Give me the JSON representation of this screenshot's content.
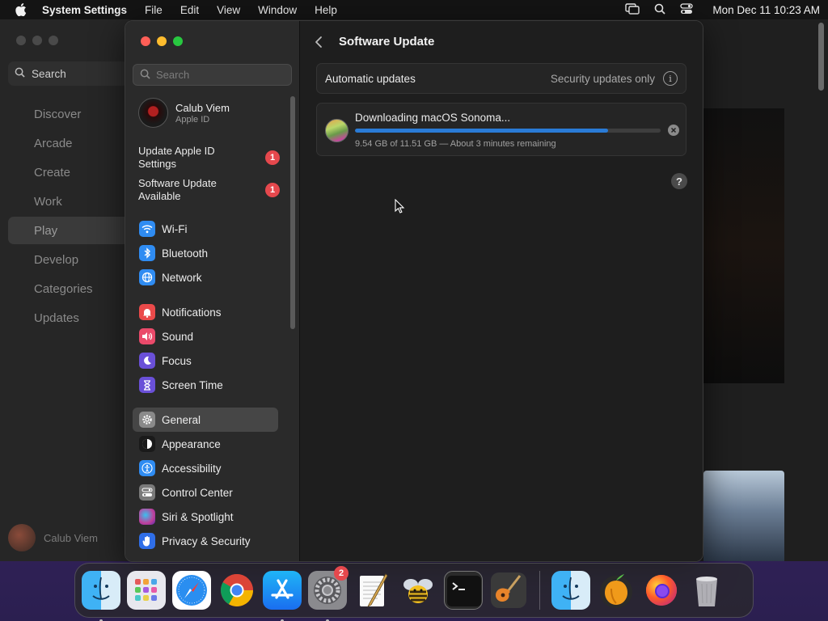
{
  "menubar": {
    "app_name": "System Settings",
    "items": [
      "File",
      "Edit",
      "View",
      "Window",
      "Help"
    ],
    "clock": "Mon Dec 11  10:23 AM"
  },
  "background_app": {
    "search_label": "Search",
    "nav": [
      "Discover",
      "Arcade",
      "Create",
      "Work",
      "Play",
      "Develop",
      "Categories",
      "Updates"
    ],
    "active_nav": "Play",
    "user_name": "Calub Viem"
  },
  "settings": {
    "search_placeholder": "Search",
    "account": {
      "name": "Calub Viem",
      "subtitle": "Apple ID"
    },
    "alerts": [
      {
        "label": "Update Apple ID Settings",
        "count": "1"
      },
      {
        "label": "Software Update Available",
        "count": "1"
      }
    ],
    "groups": [
      [
        {
          "label": "Wi-Fi",
          "icon": "wifi-icon",
          "color": "#2f8cf2"
        },
        {
          "label": "Bluetooth",
          "icon": "bluetooth-icon",
          "color": "#2f8cf2"
        },
        {
          "label": "Network",
          "icon": "globe-icon",
          "color": "#2f8cf2"
        }
      ],
      [
        {
          "label": "Notifications",
          "icon": "bell-icon",
          "color": "#ea4a4a"
        },
        {
          "label": "Sound",
          "icon": "speaker-icon",
          "color": "#ea4a6a"
        },
        {
          "label": "Focus",
          "icon": "moon-icon",
          "color": "#6a50d8"
        },
        {
          "label": "Screen Time",
          "icon": "hourglass-icon",
          "color": "#6a50d8"
        }
      ],
      [
        {
          "label": "General",
          "icon": "gear-icon",
          "color": "#8a8a8a",
          "selected": true
        },
        {
          "label": "Appearance",
          "icon": "appearance-icon",
          "color": "#1a1a1a"
        },
        {
          "label": "Accessibility",
          "icon": "accessibility-icon",
          "color": "#2f8cf2"
        },
        {
          "label": "Control Center",
          "icon": "control-center-icon",
          "color": "#7a7a7a"
        },
        {
          "label": "Siri & Spotlight",
          "icon": "siri-icon",
          "color": "#c0409a"
        },
        {
          "label": "Privacy & Security",
          "icon": "hand-icon",
          "color": "#2f6ee8"
        }
      ]
    ],
    "page_title": "Software Update",
    "automatic_updates": {
      "label": "Automatic updates",
      "value": "Security updates only"
    },
    "download": {
      "title": "Downloading macOS Sonoma...",
      "status": "9.54 GB of 11.51 GB — About 3 minutes remaining",
      "progress": 0.829
    }
  },
  "dock": {
    "apps": [
      {
        "name": "Finder",
        "running": true
      },
      {
        "name": "Launchpad",
        "running": false
      },
      {
        "name": "Safari",
        "running": false
      },
      {
        "name": "Chrome",
        "running": false
      },
      {
        "name": "App Store",
        "running": true
      },
      {
        "name": "System Settings",
        "running": true,
        "badge": "2"
      },
      {
        "name": "TextEdit",
        "running": false
      },
      {
        "name": "Bee",
        "running": false
      },
      {
        "name": "Terminal",
        "running": false
      },
      {
        "name": "GarageBand",
        "running": false
      }
    ],
    "recent": [
      {
        "name": "Finder"
      },
      {
        "name": "FL Studio"
      },
      {
        "name": "Firefox"
      },
      {
        "name": "Trash"
      }
    ]
  }
}
